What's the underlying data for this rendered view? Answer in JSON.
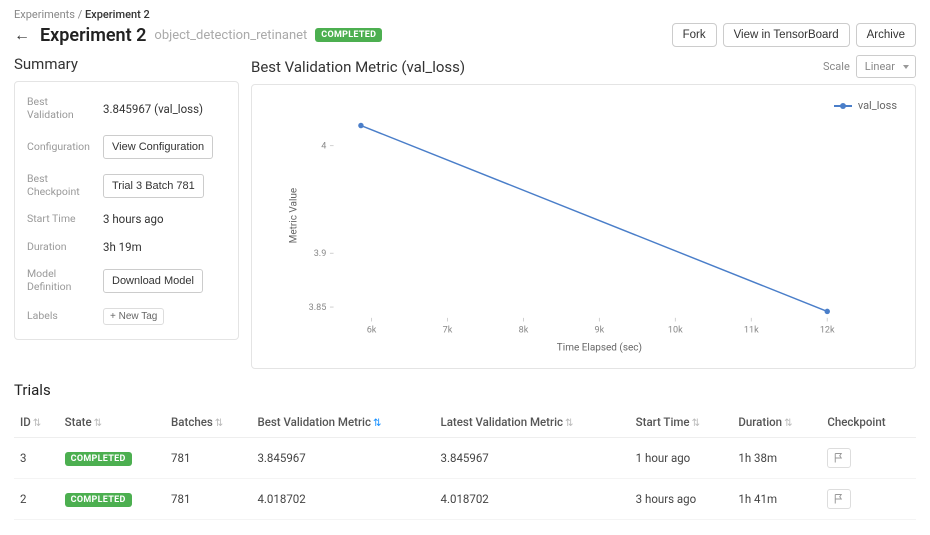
{
  "breadcrumb": {
    "root": "Experiments",
    "current": "Experiment 2"
  },
  "header": {
    "title": "Experiment 2",
    "subtitle": "object_detection_retinanet",
    "status": "COMPLETED",
    "buttons": {
      "fork": "Fork",
      "tensorboard": "View in TensorBoard",
      "archive": "Archive"
    }
  },
  "summary": {
    "title": "Summary",
    "rows": {
      "best_validation_label": "Best Validation",
      "best_validation_value": "3.845967 (val_loss)",
      "configuration_label": "Configuration",
      "configuration_button": "View Configuration",
      "best_checkpoint_label": "Best Checkpoint",
      "best_checkpoint_button": "Trial 3 Batch 781",
      "start_time_label": "Start Time",
      "start_time_value": "3 hours ago",
      "duration_label": "Duration",
      "duration_value": "3h 19m",
      "model_def_label": "Model Definition",
      "model_def_button": "Download Model",
      "labels_label": "Labels",
      "labels_button": "+ New Tag"
    }
  },
  "chart": {
    "title": "Best Validation Metric (val_loss)",
    "scale_label": "Scale",
    "scale_value": "Linear",
    "legend": "val_loss",
    "xlabel": "Time Elapsed (sec)",
    "ylabel": "Metric Value"
  },
  "chart_data": {
    "type": "line",
    "series": [
      {
        "name": "val_loss",
        "x": [
          5860,
          12000
        ],
        "y": [
          4.018702,
          3.845967
        ]
      }
    ],
    "xlabel": "Time Elapsed (sec)",
    "ylabel": "Metric Value",
    "xlim": [
      5500,
      12500
    ],
    "ylim": [
      3.84,
      4.03
    ],
    "x_ticks": [
      6000,
      7000,
      8000,
      9000,
      10000,
      11000,
      12000
    ],
    "x_tick_labels": [
      "6k",
      "7k",
      "8k",
      "9k",
      "10k",
      "11k",
      "12k"
    ],
    "y_ticks": [
      3.85,
      3.9,
      4.0
    ],
    "y_tick_labels": [
      "3.85",
      "3.9",
      "4"
    ],
    "title": "Best Validation Metric (val_loss)"
  },
  "trials": {
    "title": "Trials",
    "columns": {
      "id": "ID",
      "state": "State",
      "batches": "Batches",
      "best_metric": "Best Validation Metric",
      "latest_metric": "Latest Validation Metric",
      "start_time": "Start Time",
      "duration": "Duration",
      "checkpoint": "Checkpoint"
    },
    "rows": [
      {
        "id": "3",
        "state": "COMPLETED",
        "batches": "781",
        "best_metric": "3.845967",
        "latest_metric": "3.845967",
        "start_time": "1 hour ago",
        "duration": "1h 38m"
      },
      {
        "id": "2",
        "state": "COMPLETED",
        "batches": "781",
        "best_metric": "4.018702",
        "latest_metric": "4.018702",
        "start_time": "3 hours ago",
        "duration": "1h 41m"
      }
    ]
  }
}
